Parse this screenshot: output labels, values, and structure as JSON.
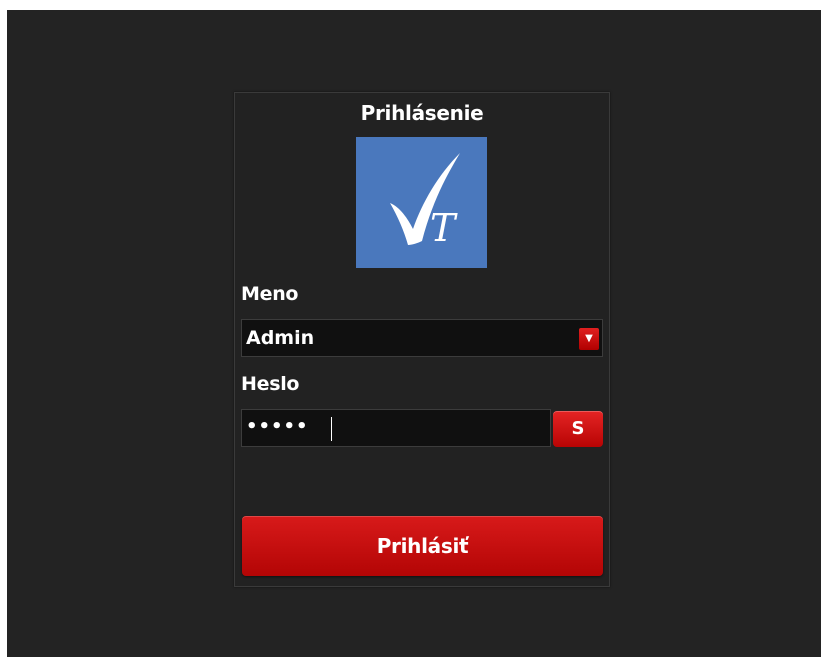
{
  "login": {
    "title": "Prihlásenie",
    "logo_icon": "checkmark-t-logo",
    "logo_letter": "T",
    "username_label": "Meno",
    "username_value": "Admin",
    "password_label": "Heslo",
    "password_value": "•••••",
    "show_password_label": "S",
    "submit_label": "Prihlásiť"
  },
  "colors": {
    "background": "#232323",
    "panel": "#222222",
    "logo": "#4a78bd",
    "accent": "#c80f0f"
  }
}
